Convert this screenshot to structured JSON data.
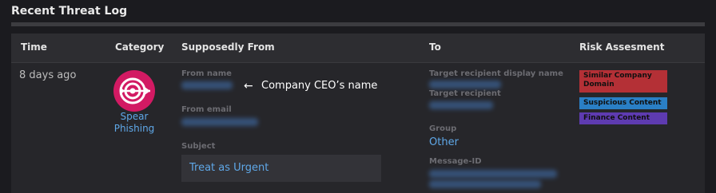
{
  "section": {
    "title": "Recent Threat Log"
  },
  "table": {
    "columns": [
      "Time",
      "Category",
      "Supposedly From",
      "To",
      "Risk Assesment"
    ]
  },
  "row": {
    "time": "8 days ago",
    "category": {
      "label": "Spear Phishing",
      "icon": "spear-phishing-target-icon",
      "color": "#d21a63"
    },
    "from": {
      "name_label": "From name",
      "email_label": "From email",
      "subject_label": "Subject",
      "subject_value": "Treat as Urgent"
    },
    "to": {
      "display_name_label": "Target recipient display name",
      "recipient_label": "Target recipient",
      "group_label": "Group",
      "group_value": "Other",
      "message_id_label": "Message-ID"
    },
    "risk": [
      {
        "label": "Similar Company Domain",
        "color": "#b43036"
      },
      {
        "label": "Suspicious Content",
        "color": "#2a7fc5"
      },
      {
        "label": "Finance Content",
        "color": "#5e3bb0"
      }
    ]
  },
  "annotation": {
    "arrow": "←",
    "text": "Company CEO’s name"
  }
}
